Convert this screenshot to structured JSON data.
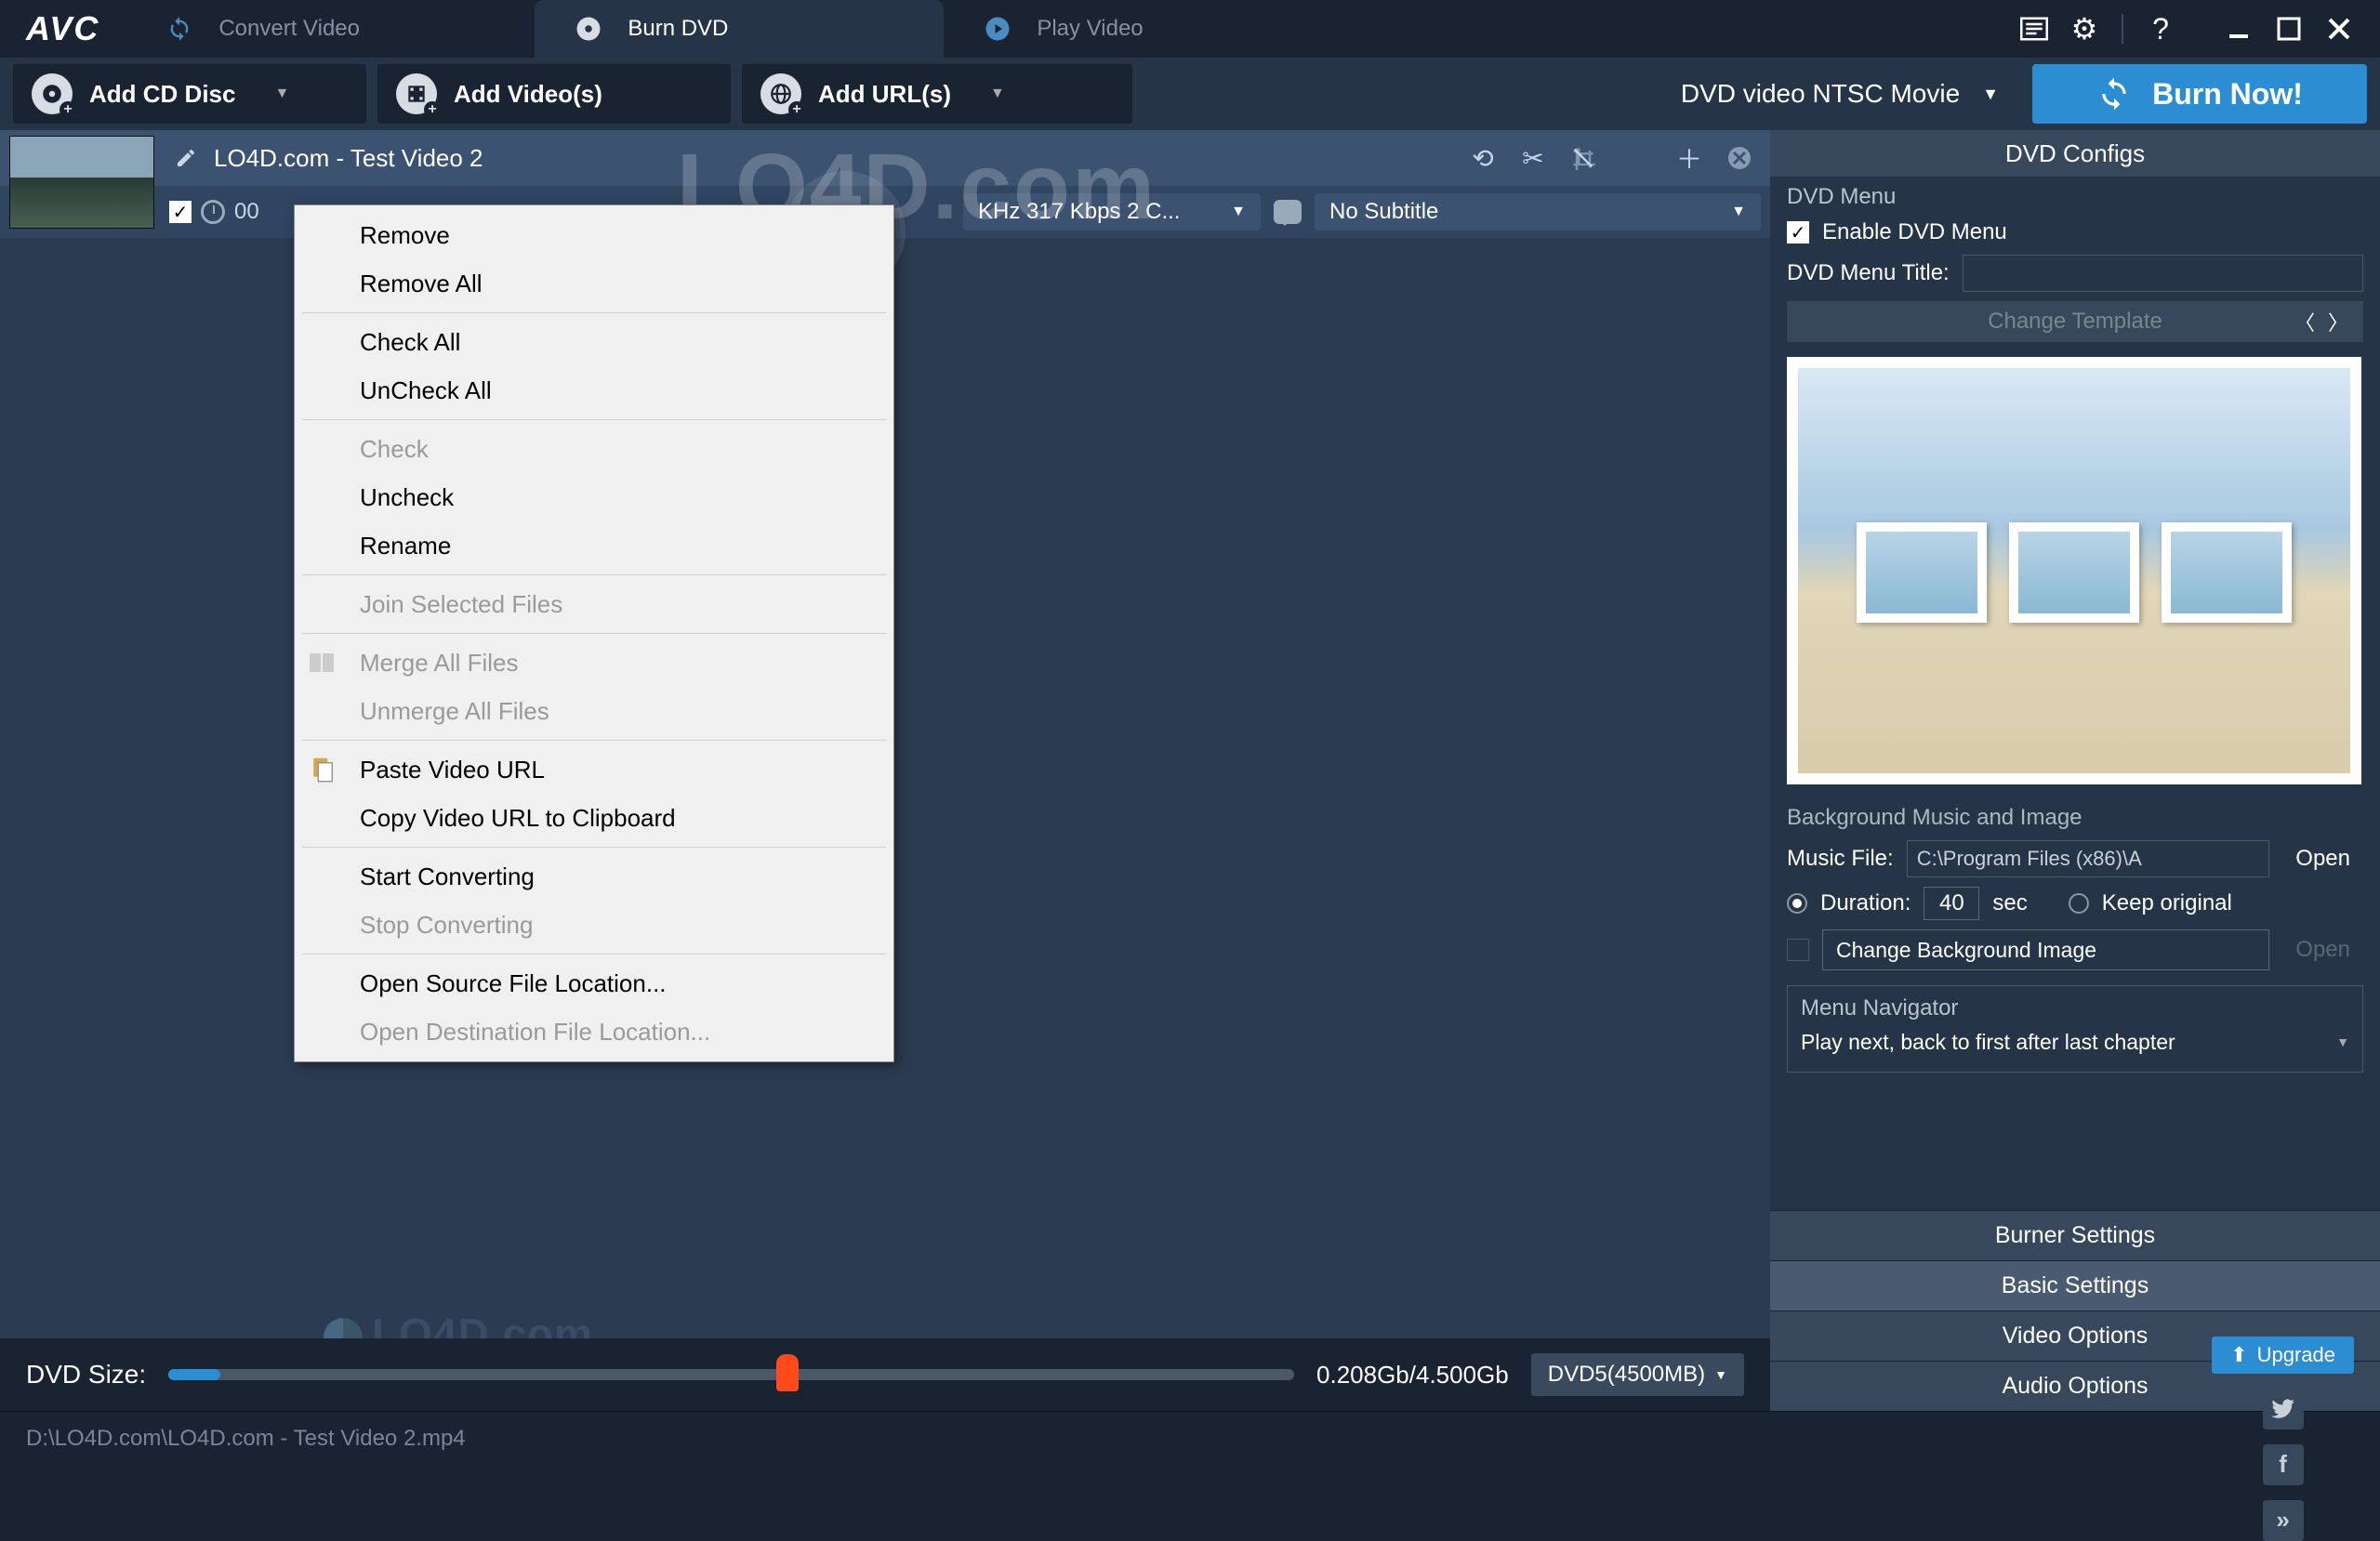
{
  "app": {
    "logo": "AVC"
  },
  "tabs": {
    "convert": "Convert Video",
    "burn": "Burn DVD",
    "play": "Play Video"
  },
  "toolbar": {
    "add_cd": "Add CD Disc",
    "add_videos": "Add Video(s)",
    "add_urls": "Add URL(s)",
    "profile": "DVD video NTSC Movie",
    "burn_now": "Burn Now!"
  },
  "video": {
    "title": "LO4D.com - Test Video 2",
    "duration_prefix": "00",
    "audio_summary": "KHz 317 Kbps 2 C...",
    "subtitle": "No Subtitle"
  },
  "context_menu": [
    {
      "label": "Remove",
      "enabled": true
    },
    {
      "label": "Remove All",
      "enabled": true
    },
    {
      "sep": true
    },
    {
      "label": "Check All",
      "enabled": true
    },
    {
      "label": "UnCheck All",
      "enabled": true
    },
    {
      "sep": true
    },
    {
      "label": "Check",
      "enabled": false
    },
    {
      "label": "Uncheck",
      "enabled": true
    },
    {
      "label": "Rename",
      "enabled": true
    },
    {
      "sep": true
    },
    {
      "label": "Join Selected Files",
      "enabled": false
    },
    {
      "sep": true
    },
    {
      "label": "Merge All Files",
      "enabled": false,
      "icon": "merge"
    },
    {
      "label": "Unmerge All Files",
      "enabled": false
    },
    {
      "sep": true
    },
    {
      "label": "Paste Video URL",
      "enabled": true,
      "icon": "paste"
    },
    {
      "label": "Copy Video URL to Clipboard",
      "enabled": true
    },
    {
      "sep": true
    },
    {
      "label": "Start Converting",
      "enabled": true
    },
    {
      "label": "Stop Converting",
      "enabled": false
    },
    {
      "sep": true
    },
    {
      "label": "Open Source File Location...",
      "enabled": true
    },
    {
      "label": "Open Destination File Location...",
      "enabled": false
    }
  ],
  "watermark": "LO4D.com",
  "dvd_size": {
    "label": "DVD Size:",
    "used_total": "0.208Gb/4.500Gb",
    "disc_type": "DVD5(4500MB)"
  },
  "right_panel": {
    "header": "DVD Configs",
    "dvd_menu_label": "DVD Menu",
    "enable_menu": "Enable DVD Menu",
    "menu_title_label": "DVD Menu Title:",
    "menu_title_value": "",
    "change_template": "Change Template",
    "bg_section": "Background Music and Image",
    "music_file_label": "Music File:",
    "music_file_value": "C:\\Program Files (x86)\\A",
    "open": "Open",
    "duration_label": "Duration:",
    "duration_value": "40",
    "sec": "sec",
    "keep_original": "Keep original",
    "change_bg": "Change Background Image",
    "nav_label": "Menu Navigator",
    "nav_value": "Play next, back to first after last chapter",
    "accordion": {
      "burner": "Burner Settings",
      "basic": "Basic Settings",
      "video": "Video Options",
      "audio": "Audio Options"
    }
  },
  "status": {
    "path": "D:\\LO4D.com\\LO4D.com - Test Video 2.mp4",
    "upgrade": "Upgrade"
  }
}
